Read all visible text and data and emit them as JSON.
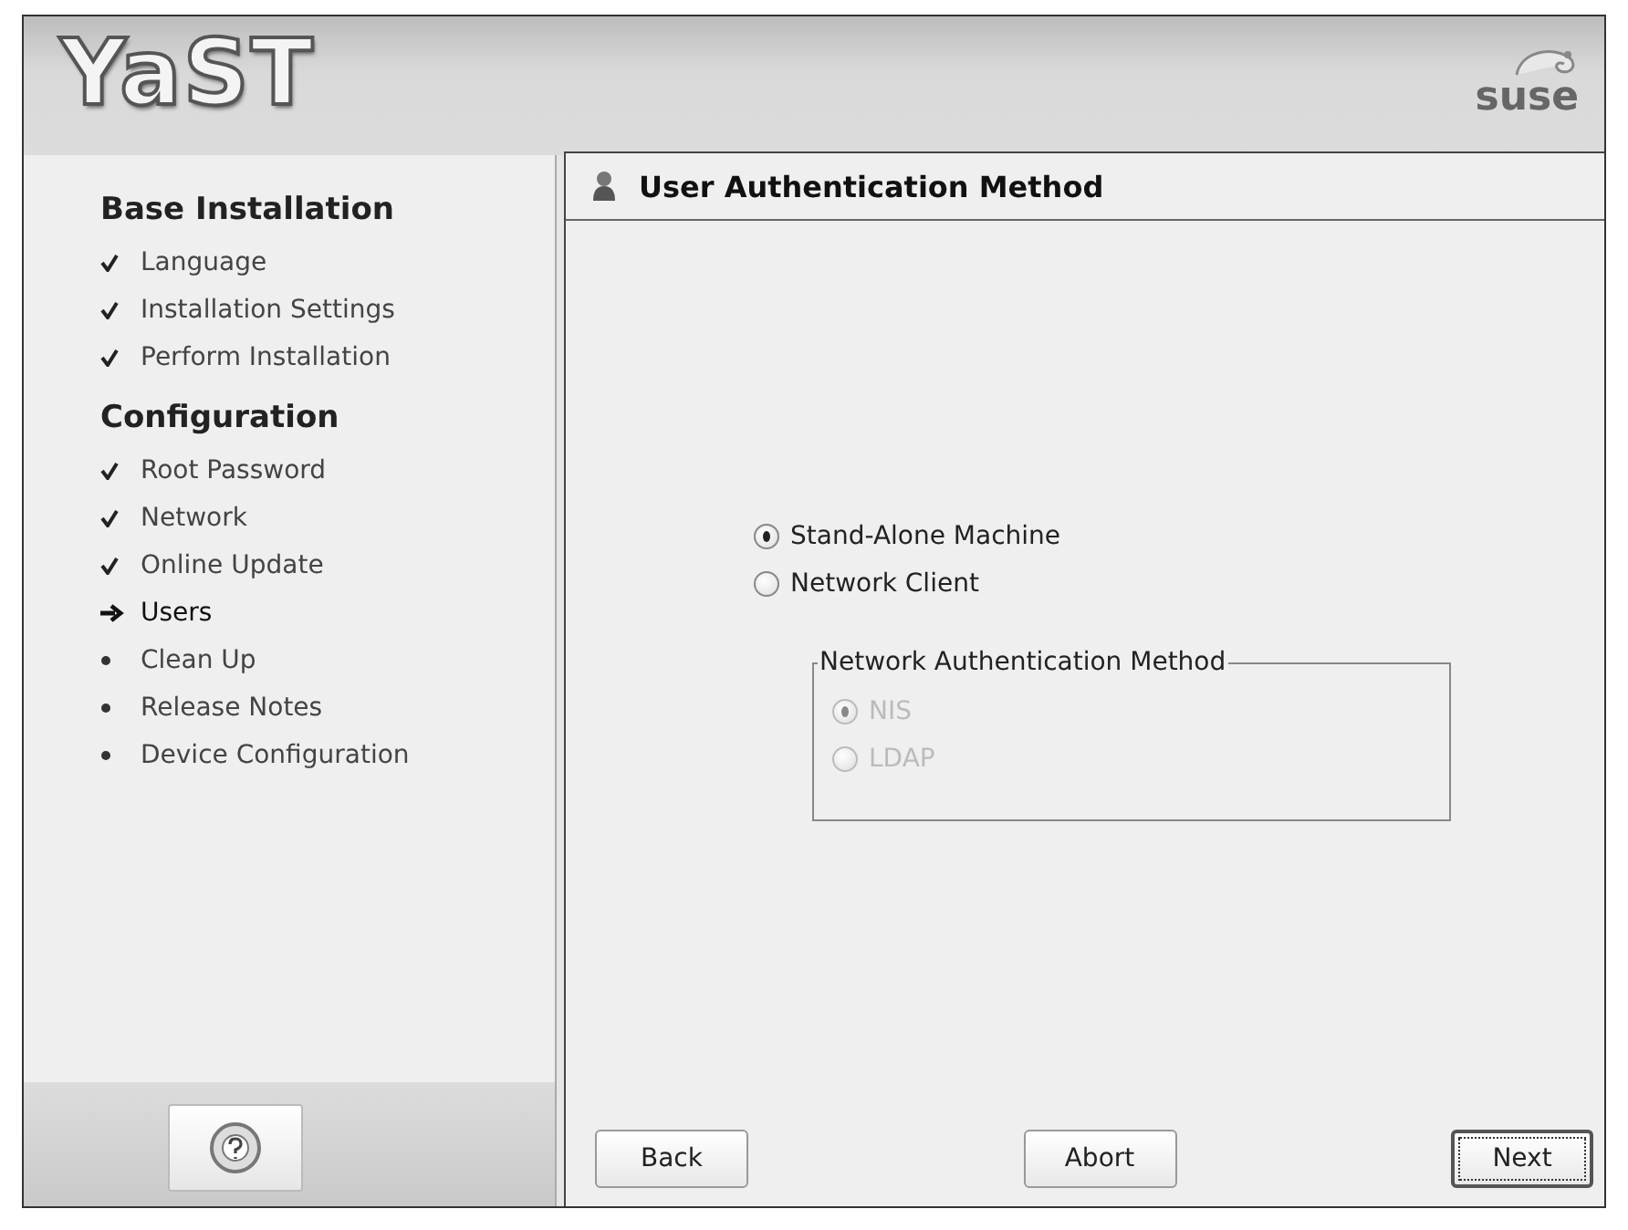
{
  "header": {
    "logo": "YaST",
    "brand": "suse"
  },
  "steps": [
    {
      "heading": "Base Installation",
      "items": [
        {
          "label": "Language",
          "kind": "done"
        },
        {
          "label": "Installation Settings",
          "kind": "done"
        },
        {
          "label": "Perform Installation",
          "kind": "done"
        }
      ]
    },
    {
      "heading": "Configuration",
      "items": [
        {
          "label": "Root Password",
          "kind": "done"
        },
        {
          "label": "Network",
          "kind": "done"
        },
        {
          "label": "Online Update",
          "kind": "done"
        },
        {
          "label": "Users",
          "kind": "current"
        },
        {
          "label": "Clean Up",
          "kind": "pending"
        },
        {
          "label": "Release Notes",
          "kind": "pending"
        },
        {
          "label": "Device Configuration",
          "kind": "pending"
        }
      ]
    }
  ],
  "dialog": {
    "title": "User Authentication Method",
    "options": [
      {
        "label": "Stand-Alone Machine",
        "selected": true,
        "disabled": false
      },
      {
        "label": "Network Client",
        "selected": false,
        "disabled": false
      }
    ],
    "group": {
      "title": "Network Authentication Method",
      "options": [
        {
          "label": "NIS",
          "selected": true,
          "disabled": true
        },
        {
          "label": "LDAP",
          "selected": false,
          "disabled": true
        }
      ]
    }
  },
  "buttons": [
    {
      "label": "Back",
      "focused": false
    },
    {
      "label": "Abort",
      "focused": false
    },
    {
      "label": "Next",
      "focused": true
    }
  ]
}
